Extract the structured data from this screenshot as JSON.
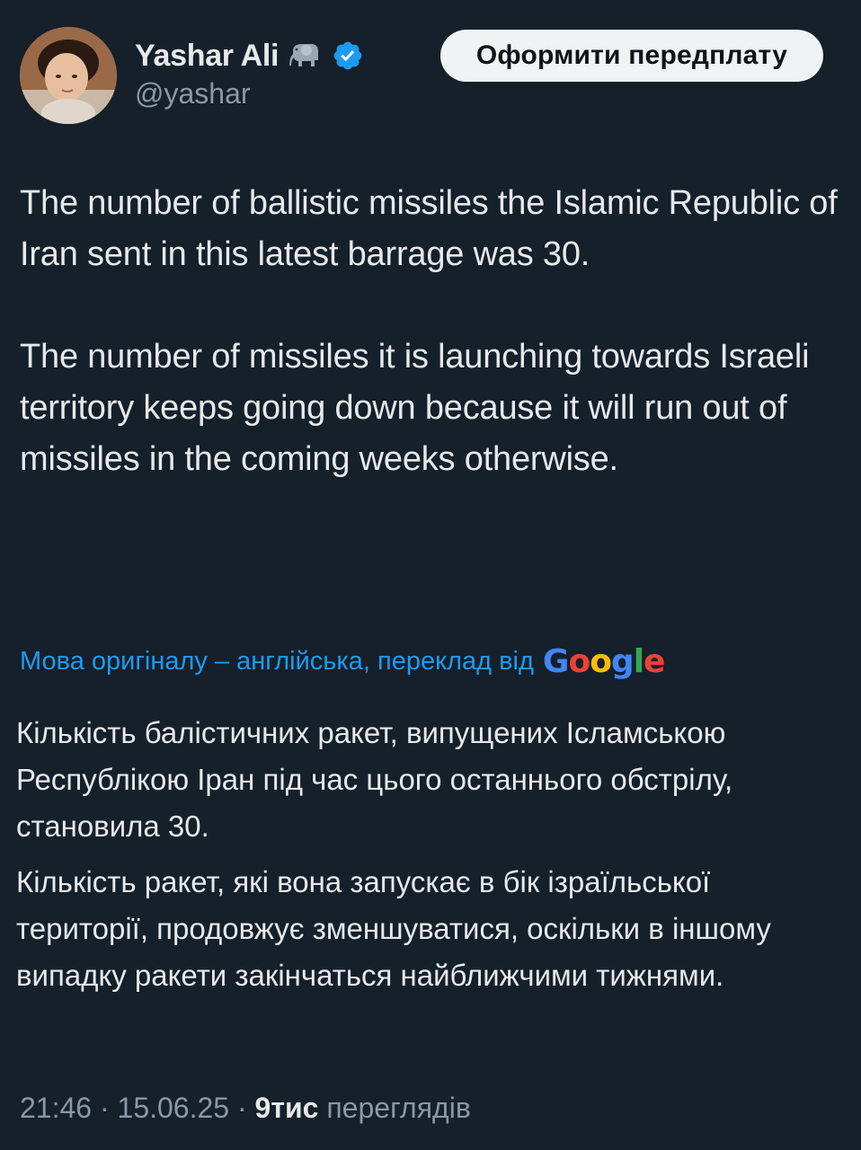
{
  "author": {
    "display_name": "Yashar Ali",
    "handle": "@yashar",
    "name_emoji": "elephant-icon",
    "verified_badge": "verified-icon"
  },
  "header": {
    "subscribe_label": "Оформити передплату"
  },
  "tweet": {
    "paragraphs": [
      "The number of ballistic missiles the Islamic Republic of Iran sent in this latest barrage was 30.",
      "The number of missiles it is launching towards Israeli territory keeps going down because it will run out of missiles in the coming weeks otherwise."
    ]
  },
  "translation": {
    "note": "Мова оригіналу – англійська, переклад від",
    "provider": "Google",
    "paragraphs": [
      "Кількість балістичних ракет, випущених Ісламською Республікою Іран під час цього останнього обстрілу, становила 30.",
      "Кількість ракет, які вона запускає в бік ізраїльської території, продовжує зменшуватися, оскільки в іншому випадку ракети закінчаться найближчими тижнями."
    ]
  },
  "meta": {
    "time": "21:46",
    "separator": " · ",
    "date": "15.06.25",
    "views_count": "9тис",
    "views_label": " переглядів"
  },
  "colors": {
    "background": "#15202b",
    "text": "#e7e9ea",
    "secondary": "#8b98a5",
    "accent": "#1d9bf0",
    "button_bg": "#eff3f4"
  }
}
